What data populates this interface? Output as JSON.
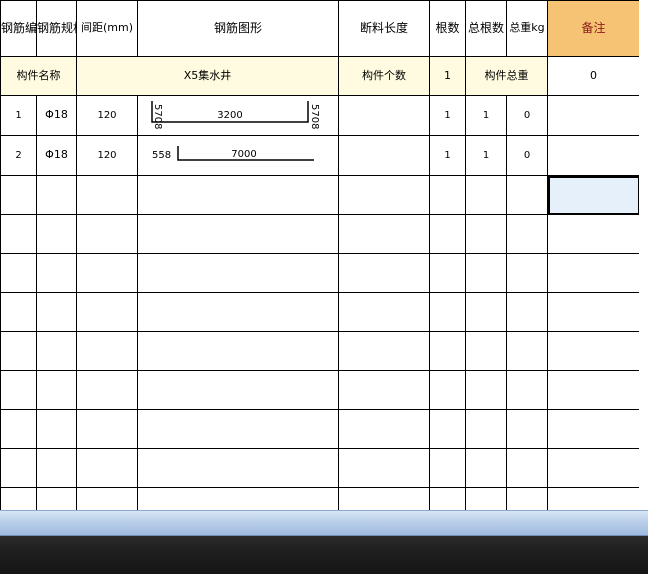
{
  "headers": {
    "bar_no": "钢筋编号",
    "spec": "钢筋规格",
    "spacing": "间距(mm)",
    "shape": "钢筋图形",
    "cut_length": "断料长度",
    "count": "根数",
    "total_count": "总根数",
    "total_weight": "总重kg",
    "remarks": "备注"
  },
  "component": {
    "name_label": "构件名称",
    "name_value": "X5集水井",
    "qty_label": "构件个数",
    "qty_value": "1",
    "weight_label": "构件总重",
    "weight_value": "0"
  },
  "rows": [
    {
      "no": "1",
      "spec": "Φ18",
      "spacing": "120",
      "shape": {
        "type": "U",
        "left": "5708",
        "middle": "3200",
        "right": "5708"
      },
      "cut_length": "",
      "count": "1",
      "total_count": "1",
      "total_weight": "0",
      "remarks": ""
    },
    {
      "no": "2",
      "spec": "Φ18",
      "spacing": "120",
      "shape": {
        "type": "L",
        "left": "558",
        "middle": "7000"
      },
      "cut_length": "",
      "count": "1",
      "total_count": "1",
      "total_weight": "0",
      "remarks": ""
    }
  ],
  "empty_rows": 9,
  "colors": {
    "remarks_header_bg": "#f5c373",
    "remarks_header_text": "#8b1a1a",
    "component_row_bg": "#fffbe0",
    "selection_fill": "#e6f0fb"
  }
}
